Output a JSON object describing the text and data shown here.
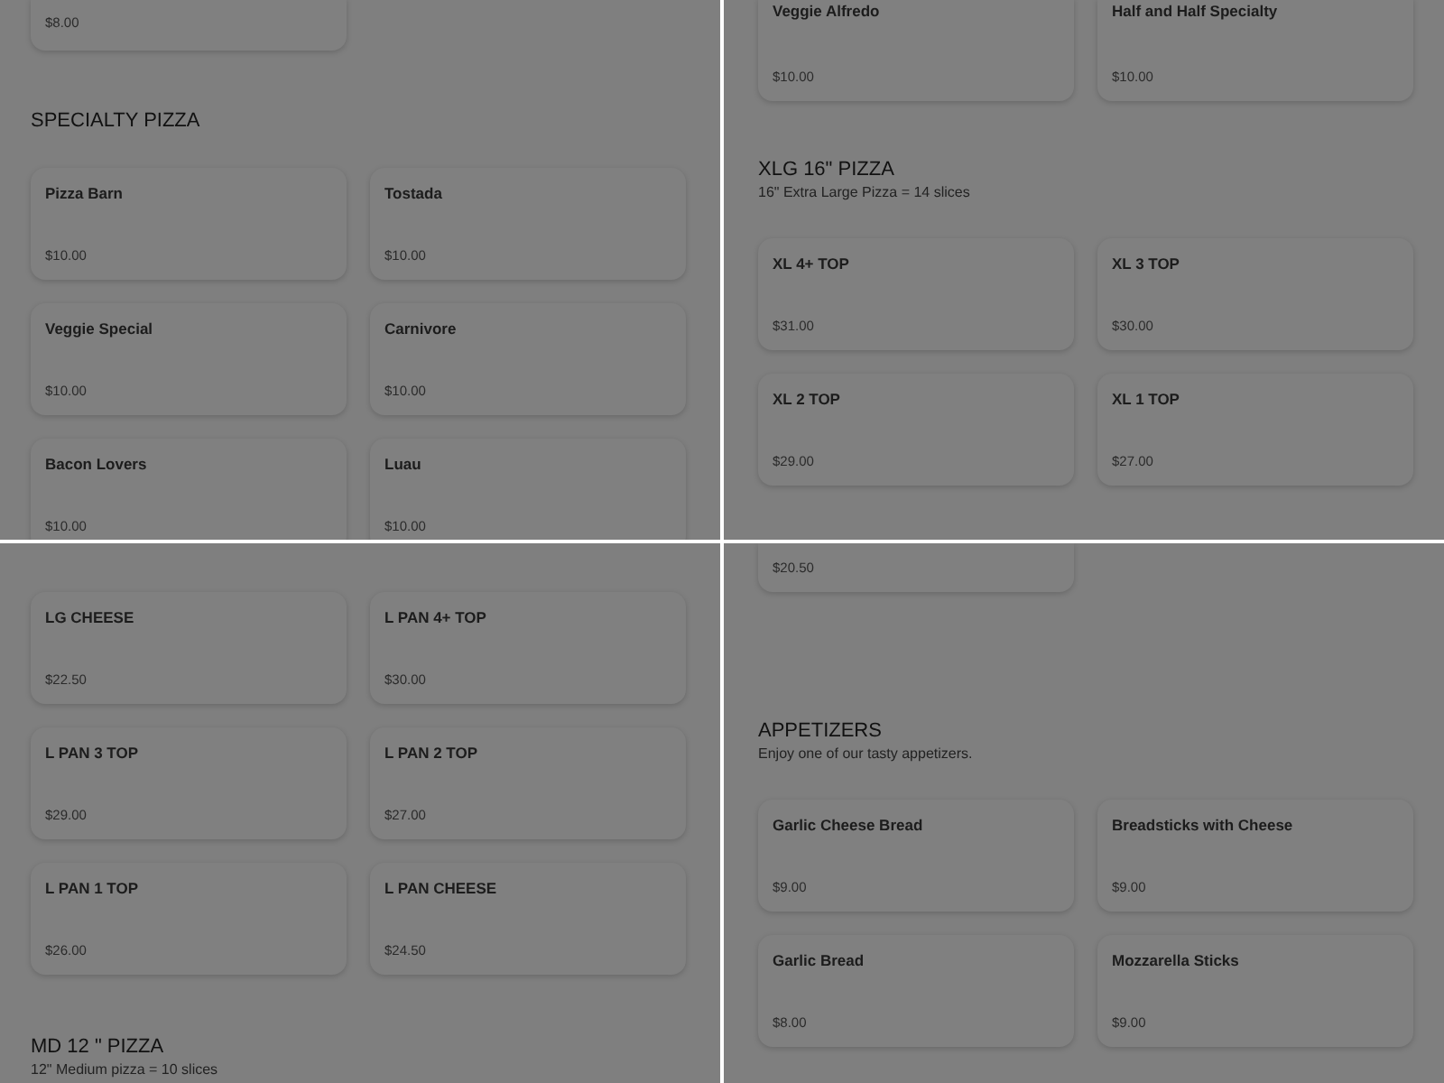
{
  "panels": [
    {
      "blocks": [
        {
          "kind": "cut-cards",
          "cards": [
            {
              "price": "$8.00"
            }
          ]
        },
        {
          "kind": "section",
          "title": "SPECIALTY PIZZA"
        },
        {
          "kind": "cards",
          "cards": [
            {
              "name": "Pizza Barn",
              "price": "$10.00"
            },
            {
              "name": "Tostada",
              "price": "$10.00"
            },
            {
              "name": "Veggie Special",
              "price": "$10.00"
            },
            {
              "name": "Carnivore",
              "price": "$10.00"
            },
            {
              "name": "Bacon Lovers",
              "price": "$10.00"
            },
            {
              "name": "Luau",
              "price": "$10.00"
            }
          ]
        }
      ]
    },
    {
      "blocks": [
        {
          "kind": "cut-cards",
          "cards": [
            {
              "name": "Veggie Alfredo",
              "price": "$10.00"
            },
            {
              "name": "Half and Half Specialty",
              "price": "$10.00"
            }
          ]
        },
        {
          "kind": "section",
          "title": "XLG 16\" PIZZA",
          "subtitle": "16\" Extra Large Pizza = 14 slices"
        },
        {
          "kind": "cards",
          "cards": [
            {
              "name": "XL 4+ TOP",
              "price": "$31.00"
            },
            {
              "name": "XL 3 TOP",
              "price": "$30.00"
            },
            {
              "name": "XL 2 TOP",
              "price": "$29.00"
            },
            {
              "name": "XL 1 TOP",
              "price": "$27.00"
            }
          ]
        }
      ]
    },
    {
      "blocks": [
        {
          "kind": "cards",
          "cards": [
            {
              "name": "LG CHEESE",
              "price": "$22.50"
            },
            {
              "name": "L PAN 4+ TOP",
              "price": "$30.00"
            },
            {
              "name": "L PAN 3 TOP",
              "price": "$29.00"
            },
            {
              "name": "L PAN 2 TOP",
              "price": "$27.00"
            },
            {
              "name": "L PAN 1 TOP",
              "price": "$26.00"
            },
            {
              "name": "L PAN CHEESE",
              "price": "$24.50"
            }
          ]
        },
        {
          "kind": "section",
          "title": "MD 12 \" PIZZA",
          "subtitle": "12\" Medium pizza = 10 slices"
        }
      ]
    },
    {
      "blocks": [
        {
          "kind": "cut-cards",
          "cards": [
            {
              "price": "$20.50"
            }
          ]
        },
        {
          "kind": "section",
          "title": "APPETIZERS",
          "subtitle": "Enjoy one of our tasty appetizers."
        },
        {
          "kind": "cards",
          "cards": [
            {
              "name": "Garlic Cheese Bread",
              "price": "$9.00"
            },
            {
              "name": "Breadsticks with Cheese",
              "price": "$9.00"
            },
            {
              "name": "Garlic Bread",
              "price": "$8.00"
            },
            {
              "name": "Mozzarella Sticks",
              "price": "$9.00"
            }
          ]
        }
      ]
    }
  ]
}
